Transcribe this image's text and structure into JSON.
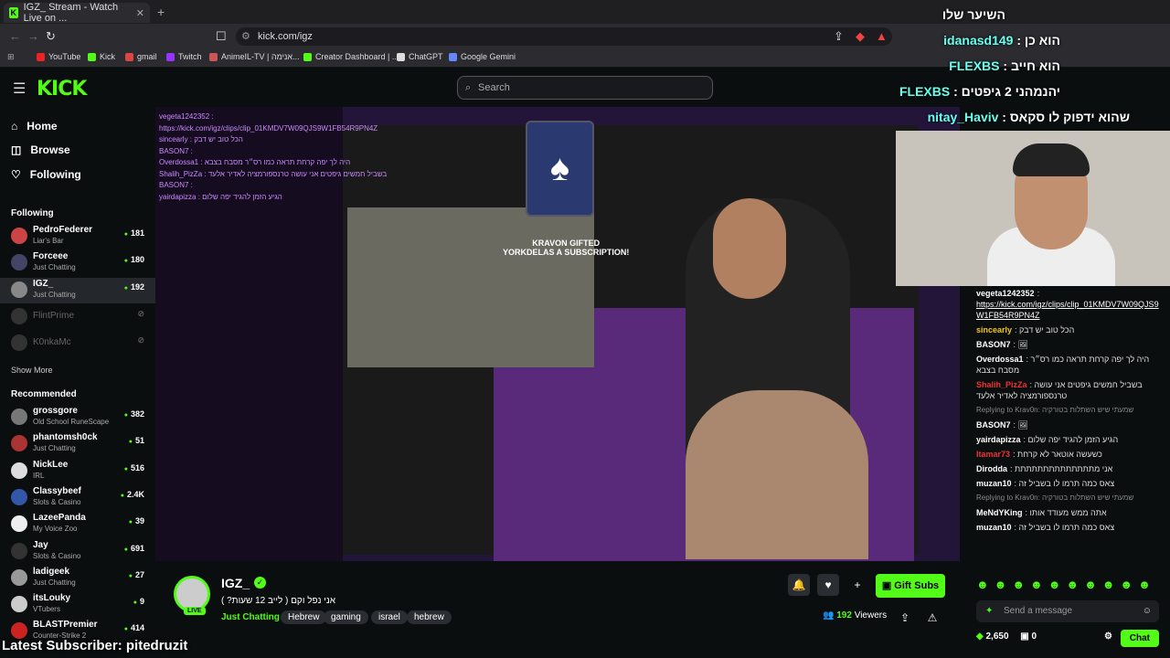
{
  "browser": {
    "tab_title": "IGZ_ Stream - Watch Live on ...",
    "url": "kick.com/igz",
    "bookmarks": [
      "YouTube",
      "Kick",
      "gmail",
      "Twitch",
      "AnimeIL-TV | אנימה...",
      "Creator Dashboard | ...",
      "ChatGPT",
      "Google Gemini"
    ]
  },
  "header": {
    "search_placeholder": "Search",
    "logo": "KICK"
  },
  "sidebar": {
    "nav": [
      "Home",
      "Browse",
      "Following"
    ],
    "following_label": "Following",
    "show_more": "Show More",
    "recommended_label": "Recommended",
    "following": [
      {
        "name": "PedroFederer",
        "cat": "Liar's Bar",
        "viewers": "181",
        "color": "#c44"
      },
      {
        "name": "Forceee",
        "cat": "Just Chatting",
        "viewers": "180",
        "color": "#446"
      },
      {
        "name": "IGZ_",
        "cat": "Just Chatting",
        "viewers": "192",
        "color": "#888"
      },
      {
        "name": "FlintPrime",
        "cat": "",
        "viewers": "",
        "color": "#333"
      },
      {
        "name": "K0nkaMc",
        "cat": "",
        "viewers": "",
        "color": "#333"
      }
    ],
    "recommended": [
      {
        "name": "grossgore",
        "cat": "Old School RuneScape",
        "viewers": "382",
        "color": "#777"
      },
      {
        "name": "phantomsh0ck",
        "cat": "Just Chatting",
        "viewers": "51",
        "color": "#a33"
      },
      {
        "name": "NickLee",
        "cat": "IRL",
        "viewers": "516",
        "color": "#ddd"
      },
      {
        "name": "Classybeef",
        "cat": "Slots & Casino",
        "viewers": "2.4K",
        "color": "#35a"
      },
      {
        "name": "LazeePanda",
        "cat": "My Voice Zoo",
        "viewers": "39",
        "color": "#eee"
      },
      {
        "name": "Jay",
        "cat": "Slots & Casino",
        "viewers": "691",
        "color": "#333"
      },
      {
        "name": "ladigeek",
        "cat": "Just Chatting",
        "viewers": "27",
        "color": "#999"
      },
      {
        "name": "itsLouky",
        "cat": "VTubers",
        "viewers": "9",
        "color": "#ccc"
      },
      {
        "name": "BLASTPremier",
        "cat": "Counter-Strike 2",
        "viewers": "414",
        "color": "#c22"
      }
    ]
  },
  "video": {
    "gifted": "KRAVON GIFTED",
    "gifted2": "YORKDELAS A SUBSCRIPTION!",
    "vchat": [
      "vegeta1242352 :",
      "https://kick.com/igz/clips/clip_01KMDV7W09QJS9W1FB54R9PN4Z",
      "sincearly : הכל טוב יש דבק",
      "BASON7 :",
      "Overdossa1 : היה לך יפה קרחת תראה כמו רס״ר מסבח בצבא",
      "Shalih_PizZa : בשביל חמשים גיפטים אני עושה טרנספורמציה לאדיר אלעד",
      "BASON7 :",
      "yairdapizza : הגיע הזמן להגיד יפה שלום"
    ]
  },
  "overlay": [
    {
      "name": "idanasd149",
      "msg": "הוא כן"
    },
    {
      "name": "FLEXBS",
      "msg": "הוא חייב"
    },
    {
      "name": "FLEXBS",
      "msg": "יהנמהני 2 גיפטים"
    },
    {
      "name": "nitay_Haviv",
      "msg": "שהוא ידפוק לו סקאס"
    }
  ],
  "overlay_top": "השיער שלו",
  "chat": [
    {
      "user": "vegeta1242352",
      "color": "#fff",
      "msg": "",
      "link": "https://kick.com/igz/clips/clip_01KMDV7W09QJS9W1FB54R9PN4Z"
    },
    {
      "user": "sincearly",
      "color": "#f5c518",
      "msg": "הכל טוב יש דבק"
    },
    {
      "user": "BASON7",
      "color": "#fff",
      "msg": "🖼"
    },
    {
      "user": "Overdossa1",
      "color": "#fff",
      "msg": "היה לך יפה קרחת תראה כמו רס״ר מסבח בצבא"
    },
    {
      "user": "Shalih_PizZa",
      "color": "#e33",
      "msg": "בשביל חמשים גיפטים אני עושה טרנספורמציה לאדיר אלעד"
    },
    {
      "user": "",
      "color": "#888",
      "msg": "Replying to Krav0n: שמעתי שיש השתלות בטורקיה",
      "reply": true
    },
    {
      "user": "BASON7",
      "color": "#fff",
      "msg": "🖼"
    },
    {
      "user": "yairdapizza",
      "color": "#fff",
      "msg": "הגיע הזמן להגיד יפה שלום"
    },
    {
      "user": "Itamar73",
      "color": "#e33",
      "msg": "כשעשה אוטאר לא קרחת"
    },
    {
      "user": "Dirodda",
      "color": "#fff",
      "msg": "אני מתתתתתתתתתתתתתת"
    },
    {
      "user": "muzan10",
      "color": "#fff",
      "msg": "צאס כמה תרמו לו בשביל זה"
    },
    {
      "user": "",
      "color": "#888",
      "msg": "Replying to Krav0n: שמעתי שיש השתלות בטורקיה",
      "reply": true
    },
    {
      "user": "MeNdYKing",
      "color": "#fff",
      "msg": "אתה ממש מעודד אותו"
    },
    {
      "user": "muzan10",
      "color": "#fff",
      "msg": "צאס כמה תרמו לו בשביל זה"
    }
  ],
  "chat_input": "Send a message",
  "chat_footer": {
    "points": "2,650",
    "count": "0",
    "chat": "Chat"
  },
  "stream": {
    "name": "IGZ_",
    "title": "אני נפל וקם ( לייב 12 שעות? )",
    "category": "Just Chatting",
    "tags": [
      "Hebrew",
      "gaming",
      "israel",
      "hebrew"
    ],
    "viewers": "192",
    "viewers_label": "Viewers",
    "gift": "Gift Subs",
    "live": "LIVE"
  },
  "latest_sub": "Latest Subscriber: pitedruzit"
}
